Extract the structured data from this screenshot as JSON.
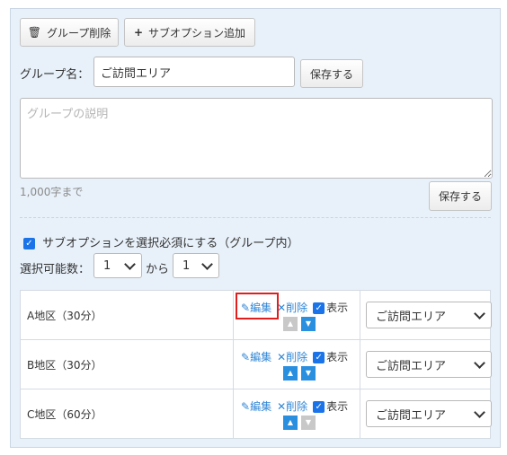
{
  "toolbar": {
    "delete_group_label": "グループ削除",
    "add_suboption_label": "サブオプション追加"
  },
  "group": {
    "name_label": "グループ名：",
    "name_value": "ご訪問エリア",
    "save_label": "保存する",
    "description_placeholder": "グループの説明",
    "description_limit": "1,000字まで",
    "description_save_label": "保存する"
  },
  "selection": {
    "required_checkbox_label": "サブオプションを選択必須にする（グループ内）",
    "count_label": "選択可能数：",
    "from_value": "1",
    "to_label": "から",
    "to_value": "1"
  },
  "options": [
    {
      "name": "A地区（30分）",
      "edit": "編集",
      "delete": "削除",
      "show": "表示",
      "up_enabled": false,
      "down_enabled": true,
      "group_value": "ご訪問エリア"
    },
    {
      "name": "B地区（30分）",
      "edit": "編集",
      "delete": "削除",
      "show": "表示",
      "up_enabled": true,
      "down_enabled": true,
      "group_value": "ご訪問エリア"
    },
    {
      "name": "C地区（60分）",
      "edit": "編集",
      "delete": "削除",
      "show": "表示",
      "up_enabled": true,
      "down_enabled": false,
      "group_value": "ご訪問エリア"
    }
  ],
  "icons": {
    "trash": "trash-icon",
    "plus": "plus-icon",
    "pencil": "pencil-icon",
    "close": "close-icon",
    "check": "checkbox-icon",
    "arrow_up": "arrow-up-icon",
    "arrow_down": "arrow-down-icon"
  },
  "colors": {
    "panel_bg": "#e8f1fa",
    "link": "#2f86d6",
    "arrow_enabled": "#2b8fe0",
    "arrow_disabled": "#c8c8c8",
    "highlight": "#e01e1e",
    "checkbox": "#1a73e8"
  }
}
